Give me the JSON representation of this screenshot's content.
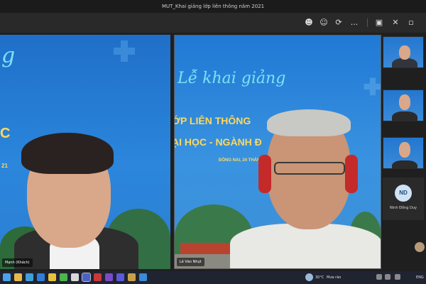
{
  "window": {
    "title": "MUT_Khai giảng lớp liên thông năm 2021"
  },
  "toolbar": {
    "icons": [
      "people-icon",
      "reactions-icon",
      "share-icon",
      "more-icon",
      "camera-icon",
      "mic-off-icon",
      "share-screen-icon"
    ],
    "more_label": "..."
  },
  "banner": {
    "script_title": "Lễ khai giảng",
    "line1": "ỚP LIÊN THÔNG",
    "line2": "ẠI HỌC - NGÀNH Đ",
    "date_fragment": "ĐỒNG NAI, 24 THÁN",
    "left_letter_top": "g",
    "left_letters_mid": "C",
    "left_digits": "21"
  },
  "participants": {
    "left_name": "Mạnh (Khách)",
    "center_name": "Lê Văn Nhựt",
    "avatar_initials": "ND",
    "avatar_name": "Ninh Đồng Duy"
  },
  "taskbar": {
    "temperature": "30°C",
    "weather": "Mưa rào",
    "language": "ENG"
  },
  "colors": {
    "accent_blue": "#2b86dc",
    "banner_yellow": "#ffd95a",
    "script_cyan": "#7fe0f4",
    "headset_red": "#c42a2a"
  }
}
